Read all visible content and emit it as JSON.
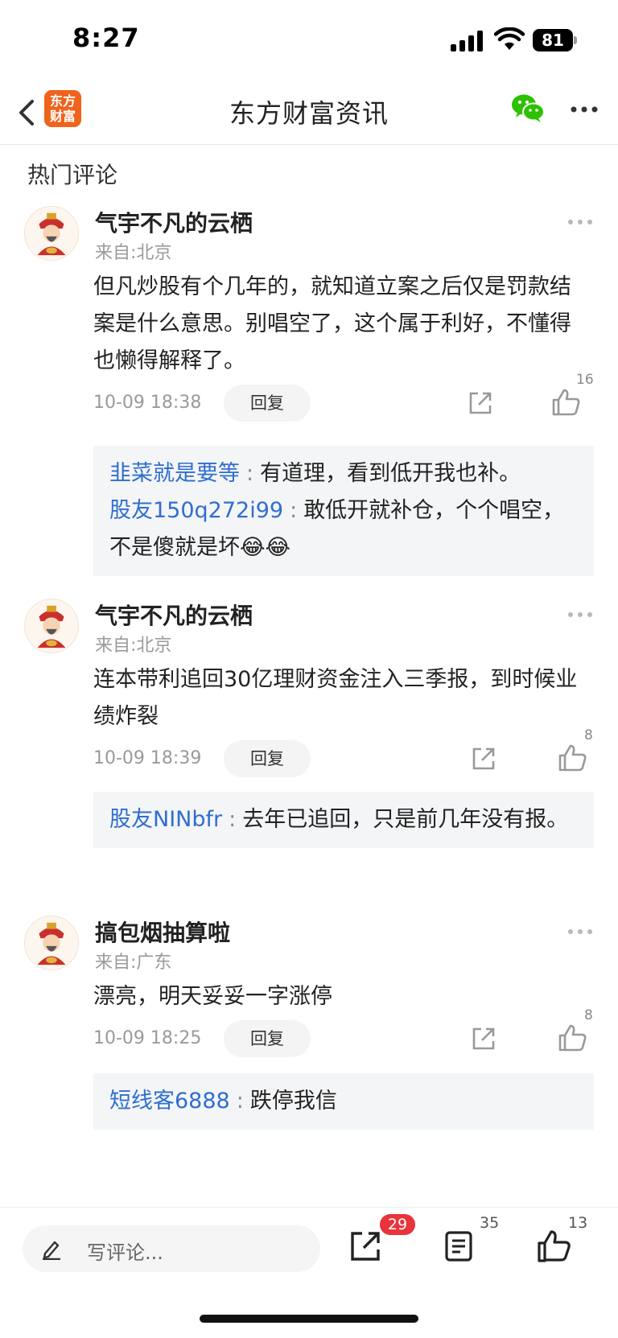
{
  "status_bar": {
    "time": "8:27",
    "battery": "81"
  },
  "nav": {
    "logo_text": "东方财富",
    "title": "东方财富资讯"
  },
  "section_title": "热门评论",
  "comments": [
    {
      "user": "气宇不凡的云栖",
      "location": "来自:北京",
      "text": "但凡炒股有个几年的，就知道立案之后仅是罚款结案是什么意思。别唱空了，这个属于利好，不懂得也懒得解释了。",
      "time": "10-09 18:38",
      "reply_label": "回复",
      "likes": "16",
      "replies": [
        {
          "user": "韭菜就是要等",
          "colon": ":",
          "text": "有道理，看到低开我也补。"
        },
        {
          "user": "股友150q272i99",
          "colon": ":",
          "text": "敢低开就补仓，个个唱空，不是傻就是坏😂😂"
        }
      ]
    },
    {
      "user": "气宇不凡的云栖",
      "location": "来自:北京",
      "text": "连本带利追回30亿理财资金注入三季报，到时候业绩炸裂",
      "time": "10-09 18:39",
      "reply_label": "回复",
      "likes": "8",
      "replies": [
        {
          "user": "股友NINbfr",
          "colon": ":",
          "text": "去年已追回，只是前几年没有报。"
        }
      ]
    },
    {
      "user": "搞包烟抽算啦",
      "location": "来自:广东",
      "text": "漂亮，明天妥妥一字涨停",
      "time": "10-09 18:25",
      "reply_label": "回复",
      "likes": "8",
      "replies": [
        {
          "user": "短线客6888",
          "colon": ":",
          "text": "跌停我信"
        }
      ]
    }
  ],
  "bottom_bar": {
    "input_placeholder": "写评论...",
    "share_count": "29",
    "comment_count": "35",
    "like_count": "13"
  },
  "colors": {
    "accent_blue": "#2f6ecf",
    "brand_orange": "#f0631c",
    "badge_red": "#e8343a",
    "wechat_green": "#2dc100"
  }
}
